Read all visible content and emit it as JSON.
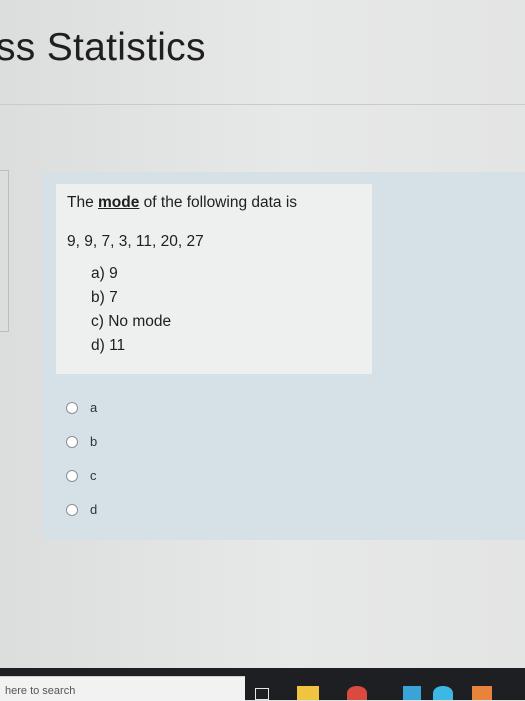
{
  "page": {
    "title": "ss Statistics"
  },
  "question": {
    "prefix": "The ",
    "keyword": "mode",
    "suffix": " of the following data is",
    "data_values": "9, 9, 7, 3, 11, 20, 27",
    "choices": [
      "a)  9",
      "b)  7",
      "c)  No mode",
      "d)  11"
    ]
  },
  "answers": [
    {
      "label": "a",
      "selected": false
    },
    {
      "label": "b",
      "selected": false
    },
    {
      "label": "c",
      "selected": false
    },
    {
      "label": "d",
      "selected": false
    }
  ],
  "taskbar": {
    "search_placeholder": "here to search",
    "icons": [
      "task-view-icon",
      "file-explorer-icon",
      "chrome-icon",
      "app-icon",
      "app-icon",
      "app-icon"
    ]
  },
  "colors": {
    "card_background": "#d5e1e6",
    "taskbar": "#1e1f22"
  }
}
